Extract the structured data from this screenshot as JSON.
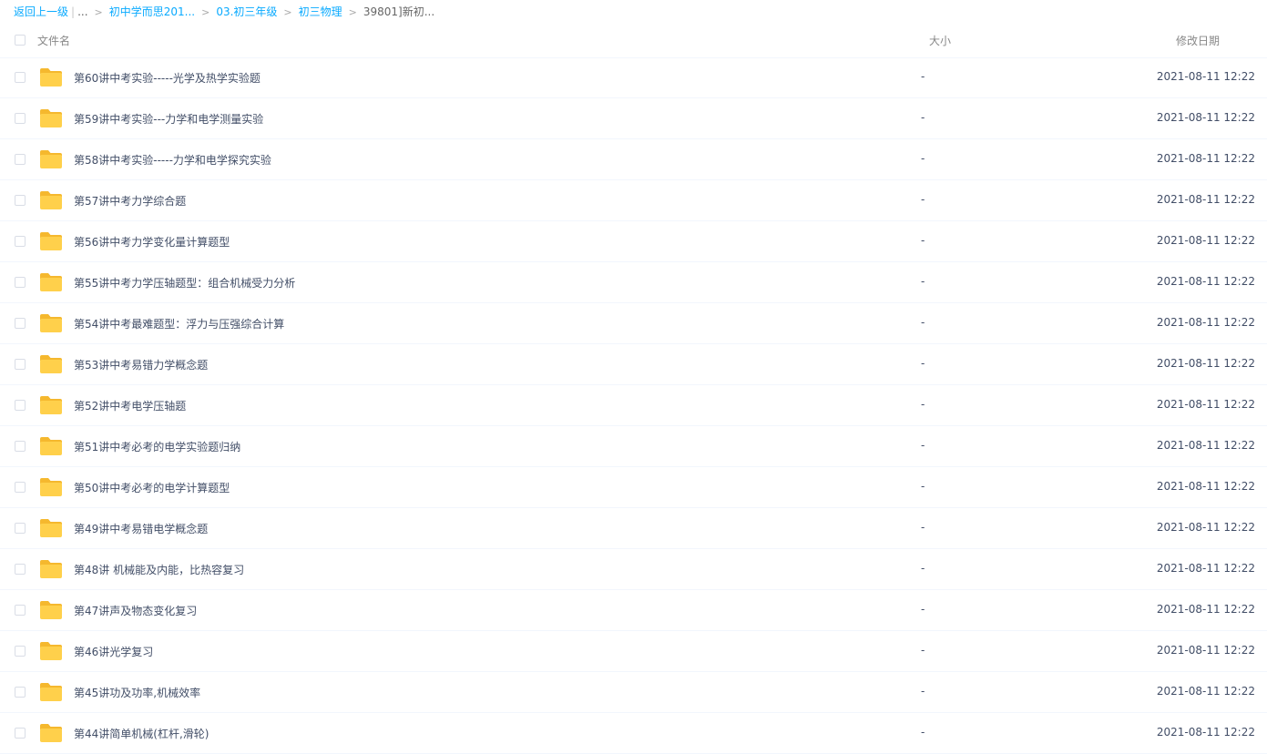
{
  "breadcrumb": {
    "back": "返回上一级",
    "separator": "|",
    "ellipsis": "...",
    "items": [
      "初中学而思201...",
      "03.初三年级",
      "初三物理"
    ],
    "current": "39801]新初..."
  },
  "header": {
    "name": "文件名",
    "size": "大小",
    "date": "修改日期"
  },
  "colors": {
    "folder": "#ffd04b",
    "folder_tab": "#f5b82e",
    "link": "#09aaff"
  },
  "files": [
    {
      "name": "第60讲中考实验-----光学及热学实验题",
      "size": "-",
      "date": "2021-08-11 12:22",
      "icon": "folder-icon"
    },
    {
      "name": "第59讲中考实验---力学和电学测量实验",
      "size": "-",
      "date": "2021-08-11 12:22",
      "icon": "folder-icon"
    },
    {
      "name": "第58讲中考实验-----力学和电学探究实验",
      "size": "-",
      "date": "2021-08-11 12:22",
      "icon": "folder-icon"
    },
    {
      "name": "第57讲中考力学综合题",
      "size": "-",
      "date": "2021-08-11 12:22",
      "icon": "folder-icon"
    },
    {
      "name": "第56讲中考力学变化量计算题型",
      "size": "-",
      "date": "2021-08-11 12:22",
      "icon": "folder-icon"
    },
    {
      "name": "第55讲中考力学压轴题型：组合机械受力分析",
      "size": "-",
      "date": "2021-08-11 12:22",
      "icon": "folder-icon"
    },
    {
      "name": "第54讲中考最难题型：浮力与压强综合计算",
      "size": "-",
      "date": "2021-08-11 12:22",
      "icon": "folder-icon"
    },
    {
      "name": "第53讲中考易错力学概念题",
      "size": "-",
      "date": "2021-08-11 12:22",
      "icon": "folder-icon"
    },
    {
      "name": "第52讲中考电学压轴题",
      "size": "-",
      "date": "2021-08-11 12:22",
      "icon": "folder-icon"
    },
    {
      "name": "第51讲中考必考的电学实验题归纳",
      "size": "-",
      "date": "2021-08-11 12:22",
      "icon": "folder-icon"
    },
    {
      "name": "第50讲中考必考的电学计算题型",
      "size": "-",
      "date": "2021-08-11 12:22",
      "icon": "folder-icon"
    },
    {
      "name": "第49讲中考易错电学概念题",
      "size": "-",
      "date": "2021-08-11 12:22",
      "icon": "folder-icon"
    },
    {
      "name": "第48讲 机械能及内能，比热容复习",
      "size": "-",
      "date": "2021-08-11 12:22",
      "icon": "folder-icon"
    },
    {
      "name": "第47讲声及物态变化复习",
      "size": "-",
      "date": "2021-08-11 12:22",
      "icon": "folder-icon"
    },
    {
      "name": "第46讲光学复习",
      "size": "-",
      "date": "2021-08-11 12:22",
      "icon": "folder-icon"
    },
    {
      "name": "第45讲功及功率,机械效率",
      "size": "-",
      "date": "2021-08-11 12:22",
      "icon": "folder-icon"
    },
    {
      "name": "第44讲简单机械(杠杆,滑轮)",
      "size": "-",
      "date": "2021-08-11 12:22",
      "icon": "folder-icon"
    }
  ]
}
